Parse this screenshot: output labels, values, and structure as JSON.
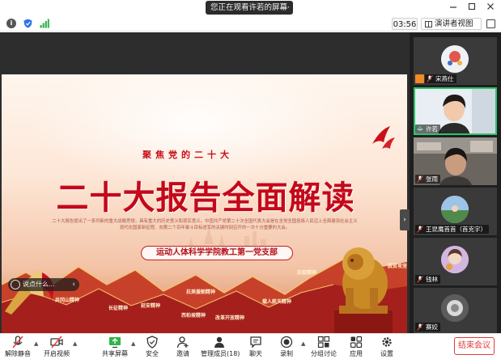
{
  "titlebar": {
    "share_status": "您正在观看许若的屏幕",
    "more_label": "⋯"
  },
  "toolbar2": {
    "timer": "03:56",
    "view_label": "演讲者视图"
  },
  "slide": {
    "top_title": "聚焦党的二十大",
    "main_title": "二十大报告全面解读",
    "paragraph": "二十大报告提出了一系列新的重大战略思想，具有重大的历史意义和现实意义。中国共产党第二十次全国代表大会是在全党全国各族人民迈上全面建设社会主义现代化国家新征程、向第二个百年奋斗目标进军的关键时刻召开的一次十分重要的大会。",
    "banner": "运动人体科学学院教工第一党支部",
    "spirit_labels": [
      "井冈山精神",
      "长征精神",
      "延安精神",
      "西柏坡精神",
      "抗美援朝精神",
      "改革开放精神",
      "载人航天精神",
      "抗疫精神",
      "脱贫攻坚精神"
    ]
  },
  "comment_box": {
    "placeholder": "说点什么..."
  },
  "participants": [
    {
      "name": "宋燕仕",
      "speaking": false,
      "host": true
    },
    {
      "name": "许若",
      "speaking": true,
      "host": false
    },
    {
      "name": "张雨",
      "speaking": false,
      "host": false
    },
    {
      "name": "王昆鹰首首（首克宇）",
      "speaking": false,
      "host": false
    },
    {
      "name": "钱林",
      "speaking": false,
      "host": false
    },
    {
      "name": "赛姣",
      "speaking": false,
      "host": false
    }
  ],
  "bottombar": {
    "items": [
      {
        "label": "解除静音",
        "icon": "mic-muted-icon"
      },
      {
        "label": "开启视频",
        "icon": "camera-off-icon"
      },
      {
        "label": "共享屏幕",
        "icon": "share-screen-icon"
      },
      {
        "label": "安全",
        "icon": "shield-icon"
      },
      {
        "label": "邀请",
        "icon": "invite-icon"
      },
      {
        "label": "管理成员(18)",
        "icon": "members-icon"
      },
      {
        "label": "聊天",
        "icon": "chat-icon"
      },
      {
        "label": "录制",
        "icon": "record-icon"
      },
      {
        "label": "分组讨论",
        "icon": "breakout-icon"
      },
      {
        "label": "应用",
        "icon": "apps-icon"
      },
      {
        "label": "设置",
        "icon": "settings-icon"
      }
    ],
    "end_label": "结束会议"
  },
  "colors": {
    "accent_red": "#c4081a",
    "speaking_green": "#2cc36b",
    "end_red": "#e03a3a",
    "host_orange": "#f08a24"
  }
}
